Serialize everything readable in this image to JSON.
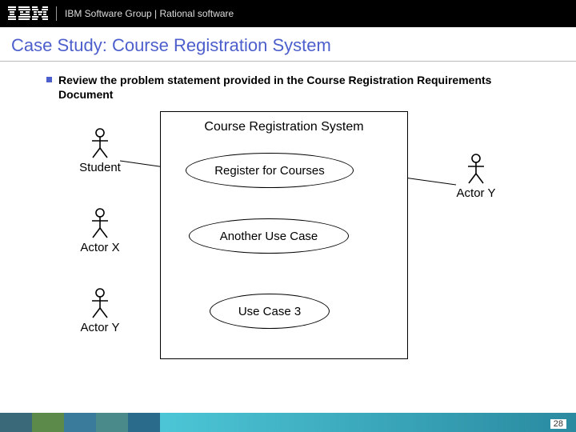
{
  "header": {
    "brand": "IBM",
    "text": "IBM Software Group | Rational software"
  },
  "title": "Case Study: Course Registration System",
  "bullet": "Review the problem statement provided in the Course Registration Requirements Document",
  "system": {
    "title": "Course Registration System"
  },
  "usecases": {
    "uc1": "Register for Courses",
    "uc2": "Another Use Case",
    "uc3": "Use Case 3"
  },
  "actors": {
    "student": "Student",
    "x": "Actor X",
    "y": "Actor Y"
  },
  "page": "28"
}
